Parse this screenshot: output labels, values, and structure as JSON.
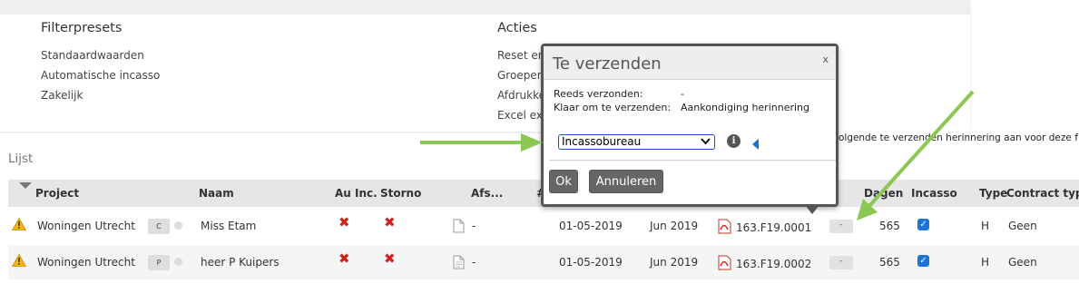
{
  "filterpresets": {
    "title": "Filterpresets",
    "items": [
      "Standaardwaarden",
      "Automatische incasso",
      "Zakelijk"
    ]
  },
  "acties": {
    "title": "Acties",
    "items": [
      "Reset er",
      "Groepere",
      "Afdrukke",
      "Excel ex"
    ]
  },
  "list_label": "Lijst",
  "table": {
    "headers": {
      "project": "Project",
      "naam": "Naam",
      "au_inc": "Au Inc.",
      "storno": "Storno",
      "afs": "Afs...",
      "hash": "#",
      "dagen": "Dagen",
      "incasso": "Incasso",
      "type": "Type",
      "contract_type": "Contract type"
    },
    "rows": [
      {
        "project": "Woningen Utrecht",
        "code": "C",
        "naam": "Miss Etam",
        "afs": "-",
        "date": "01-05-2019",
        "month": "Jun 2019",
        "invoice": "163.F19.0001",
        "action": "-",
        "dagen": "565",
        "type": "H",
        "contract_type": "Geen"
      },
      {
        "project": "Woningen Utrecht",
        "code": "P",
        "naam": "heer P Kuipers",
        "afs": "-",
        "date": "01-05-2019",
        "month": "Jun 2019",
        "invoice": "163.F19.0002",
        "action": "-",
        "dagen": "565",
        "type": "H",
        "contract_type": "Geen"
      }
    ]
  },
  "modal": {
    "title": "Te verzenden",
    "close": "x",
    "already_sent_label": "Reeds verzonden:",
    "already_sent_value": "-",
    "ready_label": "Klaar om te verzenden:",
    "ready_value": "Aankondiging herinnering",
    "select_value": "Incassobureau",
    "info_glyph": "i",
    "ok_label": "Ok",
    "cancel_label": "Annuleren"
  },
  "tooltip": "Pas de eerst volgende te verzenden herinnering aan voor deze f",
  "colors": {
    "annotation_arrow": "#8cc653",
    "error_red": "#d0211b",
    "checkbox_blue": "#1b75d8",
    "warning_yellow": "#f2b705"
  },
  "icons": {
    "warning": "warning-icon",
    "close": "x-mark-icon",
    "document": "document-icon",
    "pdf": "pdf-icon",
    "checkbox": "checkbox-checked-icon",
    "info": "info-icon"
  }
}
